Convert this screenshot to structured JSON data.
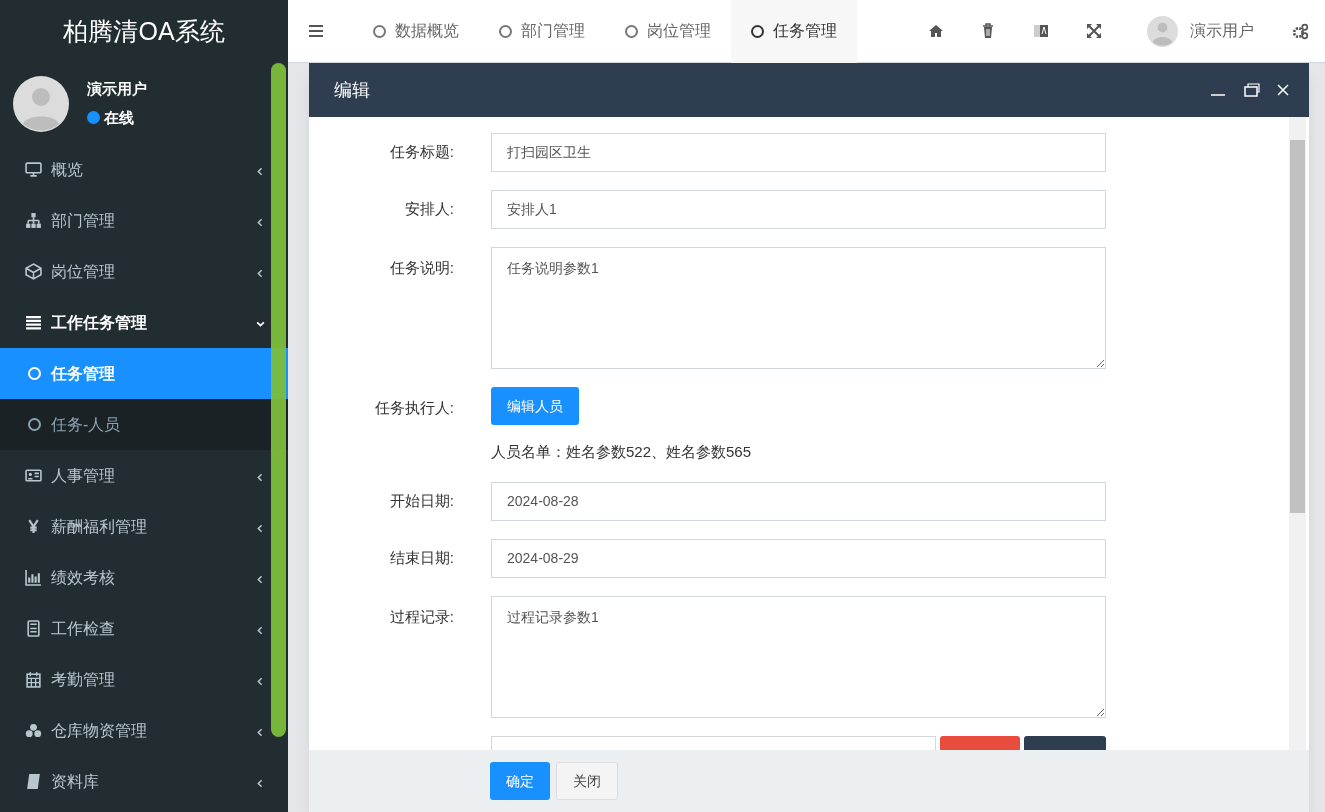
{
  "app_title": "柏腾清OA系统",
  "user": {
    "name": "演示用户",
    "status": "在线"
  },
  "sidebar": {
    "items": [
      {
        "label": "概览",
        "expanded": false
      },
      {
        "label": "部门管理",
        "expanded": false
      },
      {
        "label": "岗位管理",
        "expanded": false
      },
      {
        "label": "工作任务管理",
        "expanded": true,
        "children": [
          {
            "label": "任务管理",
            "selected": true
          },
          {
            "label": "任务-人员",
            "selected": false
          }
        ]
      },
      {
        "label": "人事管理",
        "expanded": false
      },
      {
        "label": "薪酬福利管理",
        "expanded": false
      },
      {
        "label": "绩效考核",
        "expanded": false
      },
      {
        "label": "工作检查",
        "expanded": false
      },
      {
        "label": "考勤管理",
        "expanded": false
      },
      {
        "label": "仓库物资管理",
        "expanded": false
      },
      {
        "label": "资料库",
        "expanded": false
      }
    ]
  },
  "tabs": [
    {
      "label": "数据概览",
      "selected": false
    },
    {
      "label": "部门管理",
      "selected": false
    },
    {
      "label": "岗位管理",
      "selected": false
    },
    {
      "label": "任务管理",
      "selected": true
    }
  ],
  "header_user": "演示用户",
  "dialog": {
    "title": "编辑",
    "fields": [
      {
        "kind": "input",
        "label": "任务标题:",
        "value": "打扫园区卫生"
      },
      {
        "kind": "input",
        "label": "安排人:",
        "value": "安排人1"
      },
      {
        "kind": "textarea",
        "label": "任务说明:",
        "value": "任务说明参数1"
      },
      {
        "kind": "button",
        "label": "任务执行人:",
        "button": "编辑人员",
        "note": "人员名单：姓名参数522、姓名参数565"
      },
      {
        "kind": "input",
        "label": "开始日期:",
        "value": "2024-08-28"
      },
      {
        "kind": "input",
        "label": "结束日期:",
        "value": "2024-08-29"
      },
      {
        "kind": "textarea",
        "label": "过程记录:",
        "value": "过程记录参数1"
      },
      {
        "kind": "upload"
      }
    ],
    "buttons": [
      {
        "label": "确定",
        "primary": true
      },
      {
        "label": "关闭",
        "primary": false
      }
    ]
  }
}
